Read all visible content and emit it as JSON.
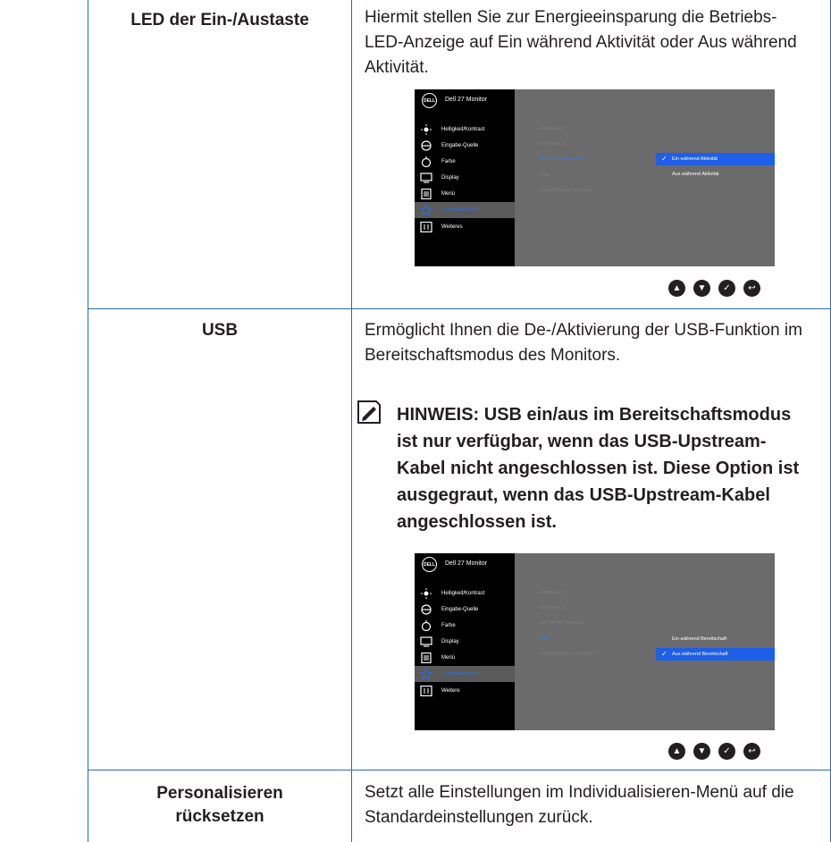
{
  "rows": [
    {
      "label": "LED der Ein-/Austaste",
      "description": "Hiermit stellen Sie zur Energieeinsparung die Betriebs-LED-Anzeige auf Ein während Aktivität oder Aus während Aktivität."
    },
    {
      "label": "USB",
      "description": "Ermöglicht Ihnen die De-/Aktivierung der USB-Funktion im Bereitschaftsmodus des Monitors.",
      "note": "HINWEIS: USB ein/aus im Bereitschaftsmodus ist nur verfügbar, wenn das USB-Upstream-Kabel nicht angeschlossen ist. Diese Option ist ausgegraut, wenn das USB-Upstream-Kabel angeschlossen ist."
    },
    {
      "label_line1": "Personalisieren",
      "label_line2": "rücksetzen",
      "description": "Setzt alle Einstellungen im Individualisieren-Menü auf die Standardeinstellungen zurück."
    }
  ],
  "osd1": {
    "brand": "DELL",
    "model": "Dell 27 Monitor",
    "menu": [
      "Helligkeit/Kontrast",
      "Eingabe-Quelle",
      "Farbe",
      "Display",
      "Menü",
      "Individualisieren",
      "Weiteres"
    ],
    "sub": [
      "Direkttaste 1",
      "Direkttaste 2",
      "LED der Ein-/Austaste",
      "USB",
      "Personalisieren rücksetzen"
    ],
    "options": [
      "Ein während Aktivität",
      "Aus während Aktivität"
    ],
    "selected_option": "Ein während Aktivität"
  },
  "osd2": {
    "brand": "DELL",
    "model": "Dell 27 Monitor",
    "menu": [
      "Helligkeit/Kontrast",
      "Eingabe-Quelle",
      "Farbe",
      "Display",
      "Menü",
      "Individualisieren",
      "Weitere"
    ],
    "sub": [
      "Direkttaste 1",
      "Direkttaste 2",
      "LED der Ein-/Austaste",
      "USB",
      "Personalisieren rücksetzen ?"
    ],
    "options": [
      "Ein während Bereitschaft",
      "Aus während Bereitschaft"
    ],
    "selected_option": "Aus während Bereitschaft"
  },
  "icons": {
    "note": "pencil-note-icon",
    "nav": [
      "up-arrow-icon",
      "down-arrow-icon",
      "check-icon",
      "back-icon"
    ]
  },
  "colors": {
    "table_border": "#2b6aa8",
    "osd_bg": "#6b6b6b",
    "osd_sidebar": "#000000",
    "osd_highlight": "#1d5fe8",
    "osd_active_text": "#2c6fd6"
  }
}
